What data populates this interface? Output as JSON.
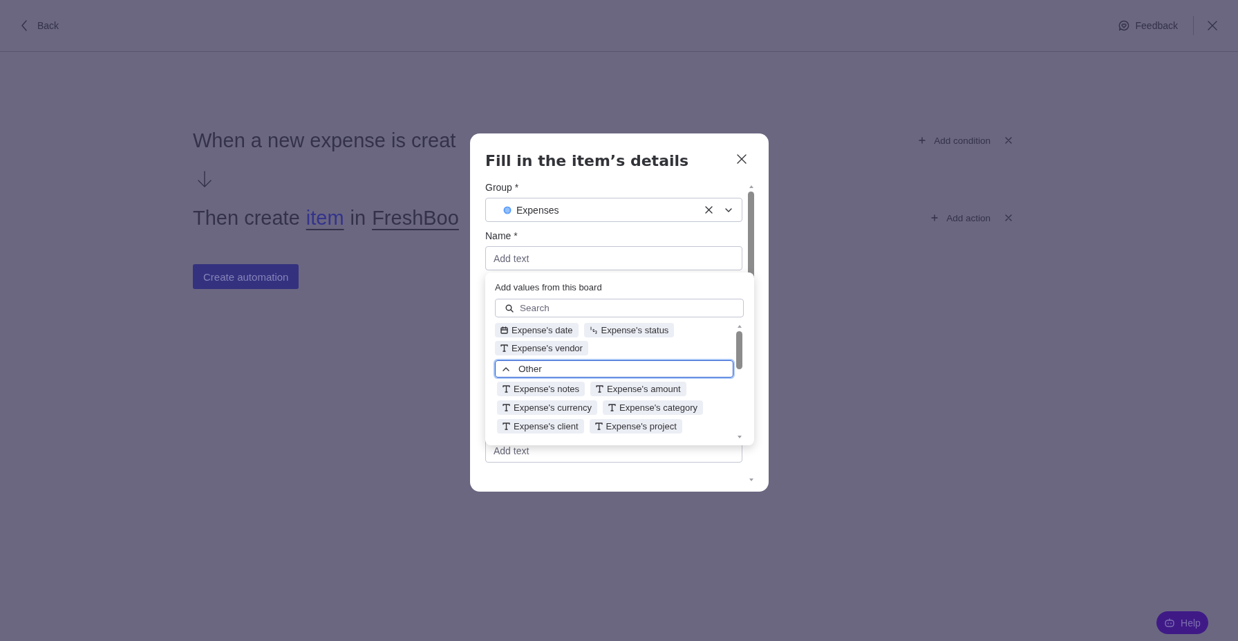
{
  "top_bar": {
    "back": "Back",
    "feedback": "Feedback"
  },
  "recipe": {
    "trigger": "When a new expense is creat",
    "action": [
      {
        "text": "Then create",
        "kind": "plain"
      },
      {
        "text": "item",
        "kind": "link"
      },
      {
        "text": "in",
        "kind": "plain"
      },
      {
        "text": "FreshBoo",
        "kind": "field"
      }
    ],
    "add_condition": "Add condition",
    "add_action": "Add action",
    "create_button": "Create automation"
  },
  "dialog": {
    "title": "Fill in the item’s details",
    "fields": [
      {
        "label": "Group *",
        "kind": "select",
        "value": "Expenses",
        "color": "#579bfc"
      },
      {
        "label": "Name *",
        "kind": "text",
        "placeholder": "Add text"
      },
      {
        "kind": "text",
        "placeholder": "Add text"
      }
    ]
  },
  "values_popover": {
    "title": "Add values from this board",
    "search_placeholder": "Search",
    "chips": [
      {
        "label": "Expense's date",
        "kind": "date"
      },
      {
        "label": "Expense's status",
        "kind": "number"
      },
      {
        "label": "Expense's vendor",
        "kind": "text"
      }
    ],
    "groups": [
      {
        "label": "Other",
        "expanded": true,
        "focused": true,
        "chips": [
          {
            "label": "Expense's notes",
            "kind": "text"
          },
          {
            "label": "Expense's amount",
            "kind": "text"
          },
          {
            "label": "Expense's currency",
            "kind": "text"
          },
          {
            "label": "Expense's category",
            "kind": "text"
          },
          {
            "label": "Expense's client",
            "kind": "text"
          },
          {
            "label": "Expense's project",
            "kind": "text"
          }
        ]
      }
    ]
  },
  "help": "Help"
}
